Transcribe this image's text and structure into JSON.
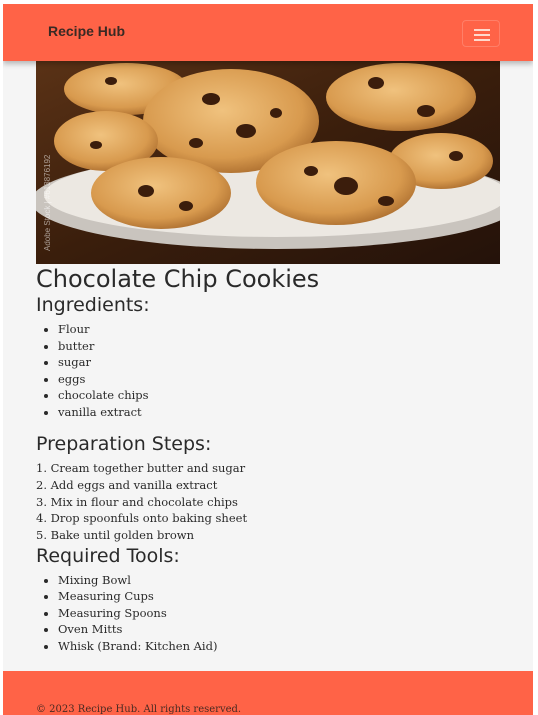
{
  "navbar": {
    "brand": "Recipe Hub",
    "menu_icon": "hamburger-menu-icon",
    "color": "#ff6347"
  },
  "hero": {
    "alt": "Plate of chocolate chip cookies",
    "watermark": "Adobe Stock | #613876192"
  },
  "recipe": {
    "title": "Chocolate Chip Cookies",
    "ingredients_heading": "Ingredients:",
    "ingredients": [
      "Flour",
      "butter",
      "sugar",
      "eggs",
      "chocolate chips",
      "vanilla extract"
    ],
    "steps_heading": "Preparation Steps:",
    "steps": [
      "1. Cream together butter and sugar",
      "2. Add eggs and vanilla extract",
      "3. Mix in flour and chocolate chips",
      "4. Drop spoonfuls onto baking sheet",
      "5. Bake until golden brown"
    ],
    "tools_heading": "Required Tools:",
    "tools": [
      "Mixing Bowl",
      "Measuring Cups",
      "Measuring Spoons",
      "Oven Mitts",
      "Whisk (Brand: Kitchen Aid)"
    ]
  },
  "footer": {
    "text": "© 2023 Recipe Hub. All rights reserved.",
    "color": "#ff6347"
  }
}
